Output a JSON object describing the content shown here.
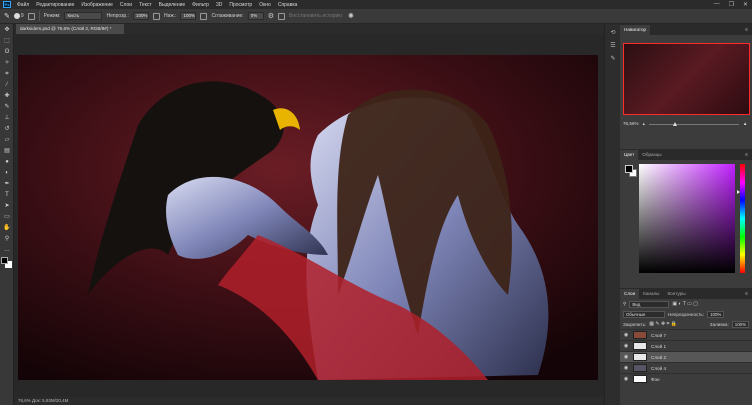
{
  "menu": {
    "logo": "Ps",
    "items": [
      "Файл",
      "Редактирование",
      "Изображение",
      "Слои",
      "Текст",
      "Выделение",
      "Фильтр",
      "3D",
      "Просмотр",
      "Окно",
      "Справка"
    ],
    "window_controls": [
      "—",
      "❐",
      "✕"
    ]
  },
  "options": {
    "brush_size": "9",
    "mode_label": "Режим:",
    "mode_value": "Кисть",
    "opacity_label": "Непрозр.:",
    "opacity_value": "100%",
    "pressure_label": "Наж.:",
    "pressure_value": "100%",
    "smoothing_label": "Сглаживание:",
    "smoothing_value": "0%",
    "restore_label": "Восстановить историю"
  },
  "document": {
    "tab_title": "darksiders.psd @ 76,6% (Слой 2, RGB/8#) *",
    "status": "76,6%   Док: 5,93M/20,4M"
  },
  "panels": {
    "navigator_tab": "Навигатор",
    "zoom_value": "76,56%",
    "color_tab": "Цвет",
    "swatches_tab": "Образцы",
    "layers_tab": "Слои",
    "channels_tab": "Каналы",
    "paths_tab": "Контуры",
    "filter_label": "Вид",
    "blend_mode": "Обычные",
    "opacity_label": "Непрозрачность:",
    "opacity_value": "100%",
    "lock_label": "Закрепить:",
    "fill_label": "Заливка:",
    "fill_value": "100%",
    "layers": [
      {
        "name": "Слой 7",
        "thumb_color": "#8a4a3a",
        "selected": false
      },
      {
        "name": "Слой 1",
        "thumb_color": "#e8e8e8",
        "selected": false
      },
      {
        "name": "Слой 2",
        "thumb_color": "#e8e8e8",
        "selected": true
      },
      {
        "name": "Слой 4",
        "thumb_color": "#555566",
        "selected": false
      },
      {
        "name": "Фон",
        "thumb_color": "#ffffff",
        "selected": false
      }
    ]
  },
  "tools": [
    "move-icon",
    "marquee-icon",
    "lasso-icon",
    "magic-wand-icon",
    "crop-icon",
    "eyedropper-icon",
    "healing-icon",
    "brush-icon",
    "stamp-icon",
    "history-brush-icon",
    "eraser-icon",
    "gradient-icon",
    "blur-icon",
    "dodge-icon",
    "pen-icon",
    "type-icon",
    "path-select-icon",
    "shape-icon",
    "hand-icon",
    "zoom-icon",
    "more-tools-icon"
  ]
}
